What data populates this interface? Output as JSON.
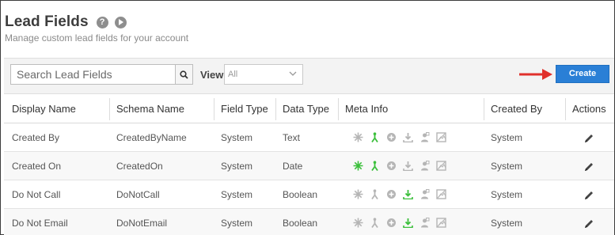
{
  "header": {
    "title": "Lead Fields",
    "subtitle": "Manage custom lead fields for your account"
  },
  "toolbar": {
    "search_placeholder": "Search Lead Fields",
    "view_label": "View",
    "view_value": "All",
    "create_label": "Create"
  },
  "table": {
    "columns": [
      "Display Name",
      "Schema Name",
      "Field Type",
      "Data Type",
      "Meta Info",
      "Created By",
      "Actions"
    ],
    "rows": [
      {
        "display_name": "Created By",
        "schema_name": "CreatedByName",
        "field_type": "System",
        "data_type": "Text",
        "created_by": "System",
        "meta": {
          "star": false,
          "person": true,
          "plus": false,
          "download": false,
          "user": false,
          "image": false
        }
      },
      {
        "display_name": "Created On",
        "schema_name": "CreatedOn",
        "field_type": "System",
        "data_type": "Date",
        "created_by": "System",
        "meta": {
          "star": true,
          "person": true,
          "plus": false,
          "download": false,
          "user": false,
          "image": false
        }
      },
      {
        "display_name": "Do Not Call",
        "schema_name": "DoNotCall",
        "field_type": "System",
        "data_type": "Boolean",
        "created_by": "System",
        "meta": {
          "star": false,
          "person": false,
          "plus": false,
          "download": true,
          "user": false,
          "image": false
        }
      },
      {
        "display_name": "Do Not Email",
        "schema_name": "DoNotEmail",
        "field_type": "System",
        "data_type": "Boolean",
        "created_by": "System",
        "meta": {
          "star": false,
          "person": false,
          "plus": false,
          "download": true,
          "user": false,
          "image": false
        }
      }
    ]
  },
  "colors": {
    "accent": "#2a7fd6",
    "meta_active": "#3bbf3b",
    "meta_inactive": "#b5b5b5",
    "arrow": "#e0302b"
  }
}
